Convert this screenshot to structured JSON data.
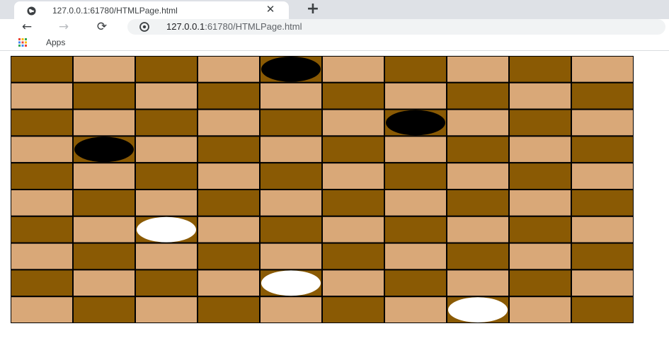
{
  "browser": {
    "tab_title": "127.0.0.1:61780/HTMLPage.html",
    "tab_close_glyph": "✕",
    "new_tab_glyph": "+",
    "back_glyph": "←",
    "forward_glyph": "→",
    "reload_glyph": "⟳",
    "url_host": "127.0.0.1",
    "url_rest": ":61780/HTMLPage.html",
    "bookmark_apps_label": "Apps",
    "icons": [
      "globe-icon",
      "close-icon",
      "plus-icon",
      "back-arrow-icon",
      "forward-arrow-icon",
      "reload-icon",
      "info-icon",
      "apps-grid-icon"
    ]
  },
  "board": {
    "rows": 10,
    "cols": 10,
    "colors": {
      "dark_square": "#8a5a04",
      "light_square": "#d9a878",
      "grid_line": "#000000",
      "black_piece": "#000000",
      "white_piece": "#ffffff"
    },
    "pieces": [
      {
        "row": 0,
        "col": 4,
        "color": "black"
      },
      {
        "row": 2,
        "col": 6,
        "color": "black"
      },
      {
        "row": 3,
        "col": 1,
        "color": "black"
      },
      {
        "row": 6,
        "col": 2,
        "color": "white"
      },
      {
        "row": 8,
        "col": 4,
        "color": "white"
      },
      {
        "row": 9,
        "col": 7,
        "color": "white"
      }
    ]
  }
}
